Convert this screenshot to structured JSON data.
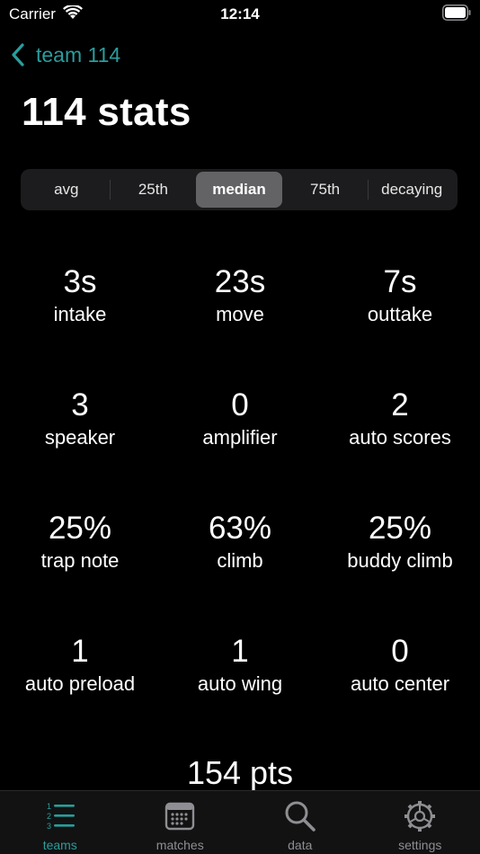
{
  "status_bar": {
    "carrier": "Carrier",
    "time": "12:14"
  },
  "nav": {
    "back_label": "team 114"
  },
  "page": {
    "title": "114 stats"
  },
  "segmented": {
    "options": [
      "avg",
      "25th",
      "median",
      "75th",
      "decaying"
    ],
    "selected": "median"
  },
  "stats": [
    [
      {
        "value": "3s",
        "label": "intake"
      },
      {
        "value": "23s",
        "label": "move"
      },
      {
        "value": "7s",
        "label": "outtake"
      }
    ],
    [
      {
        "value": "3",
        "label": "speaker"
      },
      {
        "value": "0",
        "label": "amplifier"
      },
      {
        "value": "2",
        "label": "auto scores"
      }
    ],
    [
      {
        "value": "25%",
        "label": "trap note"
      },
      {
        "value": "63%",
        "label": "climb"
      },
      {
        "value": "25%",
        "label": "buddy climb"
      }
    ],
    [
      {
        "value": "1",
        "label": "auto preload"
      },
      {
        "value": "1",
        "label": "auto wing"
      },
      {
        "value": "0",
        "label": "auto center"
      }
    ]
  ],
  "total": {
    "text": "154 pts"
  },
  "tabs": [
    {
      "label": "teams",
      "icon": "list-numbered-icon",
      "active": true
    },
    {
      "label": "matches",
      "icon": "calendar-icon",
      "active": false
    },
    {
      "label": "data",
      "icon": "magnifier-icon",
      "active": false
    },
    {
      "label": "settings",
      "icon": "gear-icon",
      "active": false
    }
  ],
  "colors": {
    "accent": "#2a9d9d",
    "background": "#000000",
    "segment_bg": "#1c1c1e",
    "segment_active": "#636366",
    "tab_inactive": "#8e8e93"
  }
}
